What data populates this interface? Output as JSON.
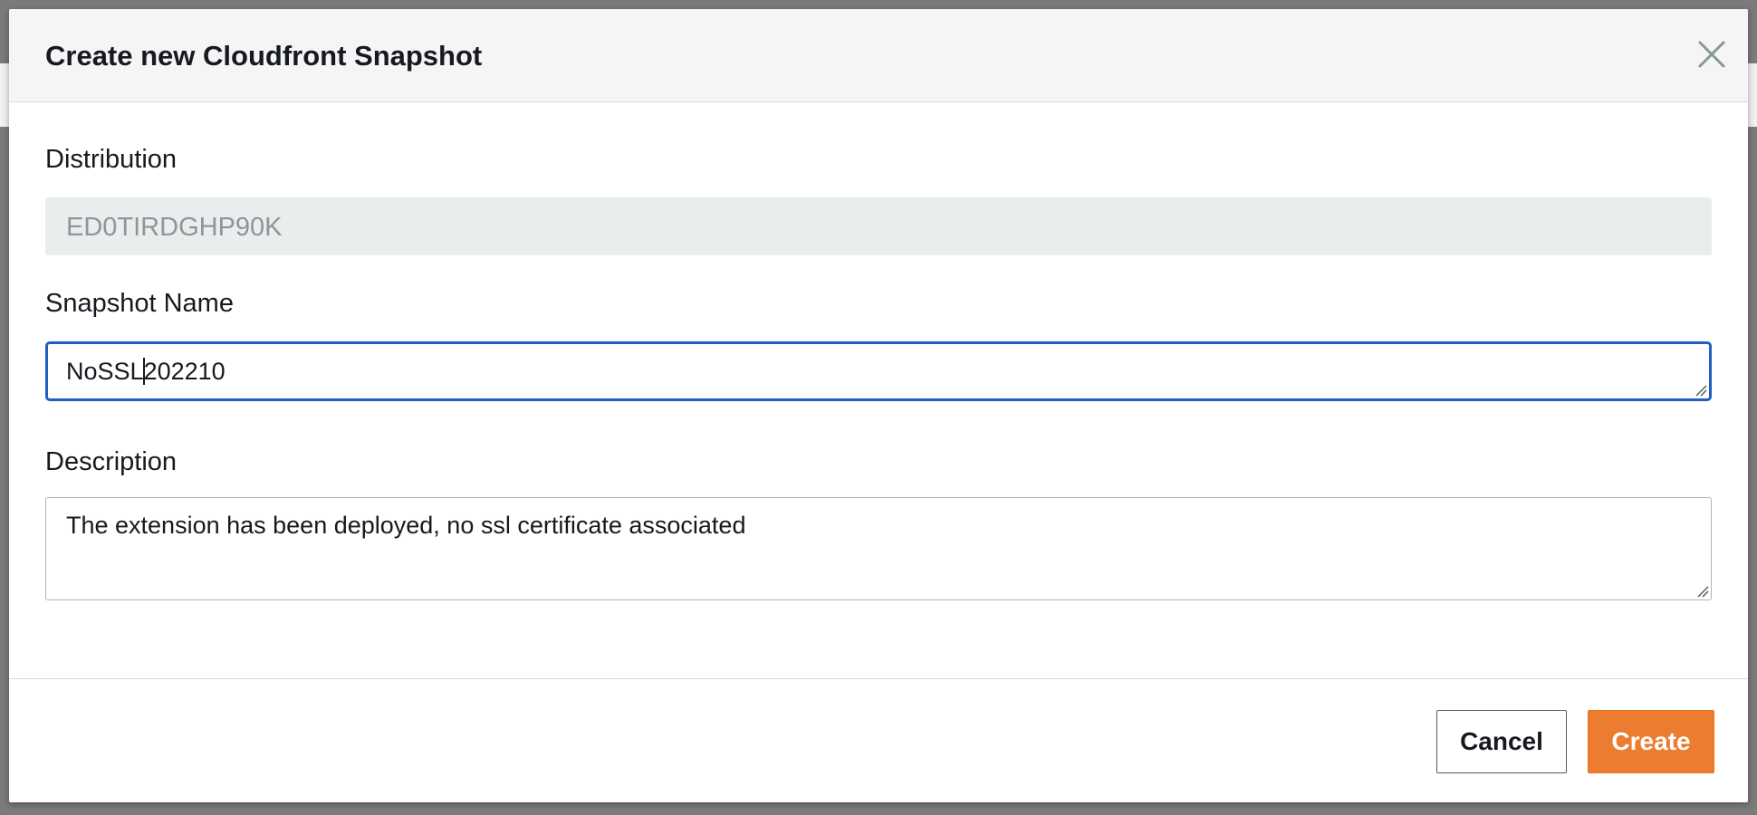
{
  "modal": {
    "title": "Create new Cloudfront Snapshot",
    "close_icon": "close-icon"
  },
  "form": {
    "distribution": {
      "label": "Distribution",
      "value": "ED0TIRDGHP90K"
    },
    "snapshot_name": {
      "label": "Snapshot Name",
      "value_before_cursor": "NoSSL",
      "value_after_cursor": "202210"
    },
    "description": {
      "label": "Description",
      "value": "The extension has been deployed, no ssl certificate associated"
    }
  },
  "footer": {
    "cancel_label": "Cancel",
    "create_label": "Create"
  },
  "colors": {
    "accent_focus": "#1f5fbf",
    "primary_button": "#ec7c2f",
    "disabled_input": "#eaeded"
  }
}
